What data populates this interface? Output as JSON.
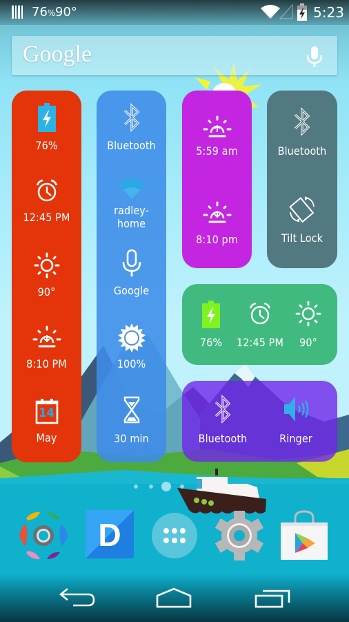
{
  "status_bar": {
    "notification_icon": "notification-bars-icon",
    "battery_percent": "76",
    "battery_suffix": "%",
    "temperature": "90°",
    "wifi_icon": "wifi-icon",
    "signal_icon": "cell-signal-empty-icon",
    "battery_icon": "battery-charging-icon",
    "time": "5:23"
  },
  "search": {
    "logo_text": "Google",
    "voice_icon": "microphone-icon"
  },
  "widgets": {
    "red_column": {
      "color": "#e4350a",
      "items": [
        {
          "icon": "battery-charging-icon",
          "label": "76%"
        },
        {
          "icon": "alarm-clock-icon",
          "label": "12:45 PM"
        },
        {
          "icon": "sun-weather-icon",
          "label": "90°"
        },
        {
          "icon": "sunset-icon",
          "label": "8:10 PM"
        },
        {
          "icon": "calendar-icon",
          "day": "14",
          "label": "May"
        }
      ]
    },
    "blue_column": {
      "color": "#3e8ce8",
      "items": [
        {
          "icon": "bluetooth-icon",
          "label": "Bluetooth"
        },
        {
          "icon": "wifi-icon",
          "label": "radley-home"
        },
        {
          "icon": "microphone-icon",
          "label": "Google"
        },
        {
          "icon": "brightness-icon",
          "label": "100%"
        },
        {
          "icon": "hourglass-icon",
          "label": "30 min"
        }
      ]
    },
    "magenta_column": {
      "color": "#c325e1",
      "items": [
        {
          "icon": "sunrise-icon",
          "label": "5:59 am"
        },
        {
          "icon": "sunset-icon",
          "label": "8:10 pm"
        }
      ]
    },
    "gray_column": {
      "color": "#527880",
      "items": [
        {
          "icon": "bluetooth-icon",
          "label": "Bluetooth"
        },
        {
          "icon": "screen-rotation-icon",
          "label": "Tilt Lock"
        }
      ]
    },
    "green_row": {
      "color": "#41ba80",
      "items": [
        {
          "icon": "battery-charging-icon",
          "label": "76%"
        },
        {
          "icon": "alarm-clock-icon",
          "label": "12:45 PM"
        },
        {
          "icon": "sun-weather-icon",
          "label": "90°"
        }
      ]
    },
    "purple_row": {
      "color": "#7026e8",
      "items": [
        {
          "icon": "bluetooth-icon",
          "label": "Bluetooth"
        },
        {
          "icon": "speaker-ringer-icon",
          "label": "Ringer"
        }
      ]
    }
  },
  "home_pages": {
    "count": 4,
    "current": 3
  },
  "dock": [
    {
      "name": "gem-launcher-app",
      "icon": "gem-app-icon"
    },
    {
      "name": "dashclock-d-app",
      "icon": "d-app-icon",
      "letter": "D"
    },
    {
      "name": "app-drawer",
      "icon": "app-drawer-icon"
    },
    {
      "name": "settings-app",
      "icon": "settings-gear-icon"
    },
    {
      "name": "play-store-app",
      "icon": "play-store-icon"
    }
  ],
  "nav_bar": {
    "back": "back-icon",
    "home": "home-icon",
    "recents": "recent-apps-icon"
  }
}
